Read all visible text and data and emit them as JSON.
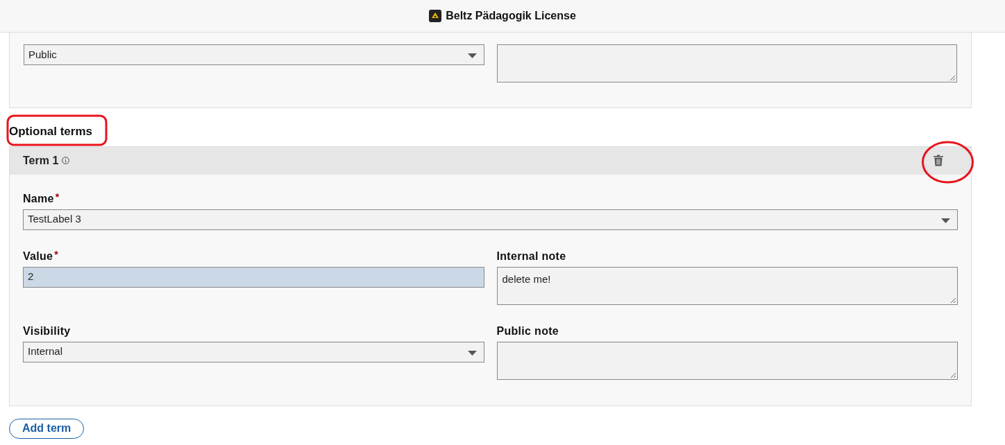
{
  "header": {
    "title": "Beltz Pädagogik License"
  },
  "top_card": {
    "rows": [
      [
        {
          "kind": "select",
          "value": "Public",
          "focused": false
        },
        {
          "kind": "textarea",
          "focused": false
        }
      ]
    ]
  },
  "section_title": "Optional terms",
  "terms": [
    {
      "title": "Term 1",
      "rows": [
        [
          {
            "label": "Name",
            "required_mark": "*",
            "kind": "select",
            "value": "TestLabel 3",
            "focused": false
          }
        ],
        [
          {
            "label": "Value",
            "required_mark": "*",
            "kind": "input",
            "value": "2",
            "focused": true
          },
          {
            "label": "Internal note",
            "kind": "textarea",
            "value": "delete me!",
            "focused": false
          }
        ],
        [
          {
            "label": "Visibility",
            "kind": "select",
            "value": "Internal",
            "focused": false
          },
          {
            "label": "Public note",
            "kind": "textarea",
            "focused": false
          }
        ]
      ]
    }
  ],
  "add_button": "Add term"
}
